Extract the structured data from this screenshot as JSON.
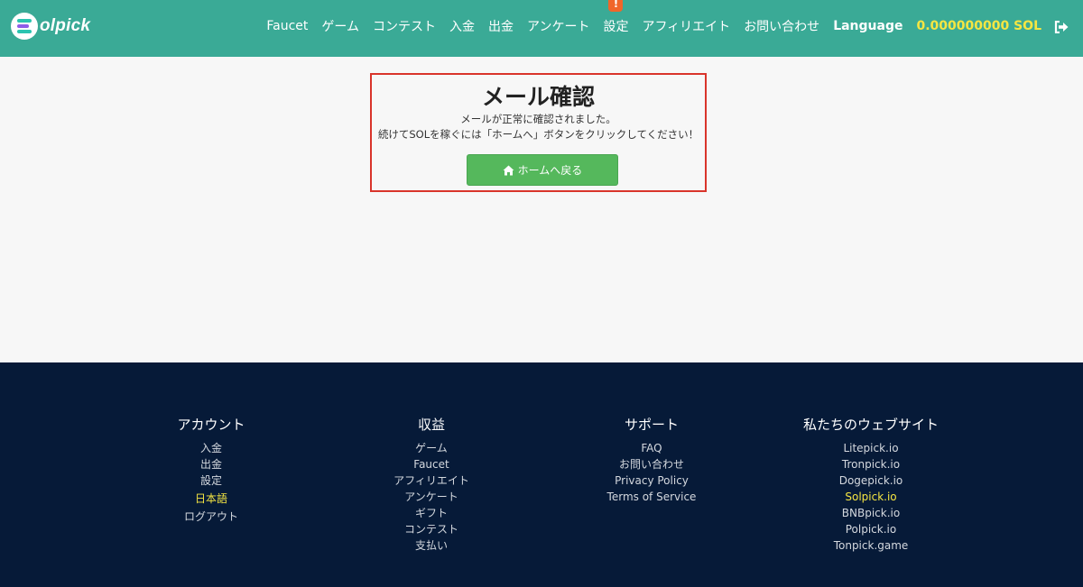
{
  "brand": {
    "name": "Solpick"
  },
  "nav": {
    "items": [
      "Faucet",
      "ゲーム",
      "コンテスト",
      "入金",
      "出金",
      "アンケート",
      "設定",
      "アフィリエイト",
      "お問い合わせ"
    ],
    "badge": "!",
    "language": "Language",
    "balance": "0.000000000 SOL",
    "logout_icon": "sign-out-icon"
  },
  "card": {
    "title": "メール確認",
    "line1": "メールが正常に確認されました。",
    "line2": "続けてSOLを稼ぐには「ホームへ」ボタンをクリックしてください！",
    "button": "ホームへ戻る",
    "button_icon": "home-icon",
    "button_color": "#55b85c",
    "highlight_color": "#d9342b"
  },
  "footer": {
    "account": {
      "title": "アカウント",
      "links": [
        "入金",
        "出金",
        "設定",
        "日本語",
        "ログアウト"
      ]
    },
    "earn": {
      "title": "収益",
      "links": [
        "ゲーム",
        "Faucet",
        "アフィリエイト",
        "アンケート",
        "ギフト",
        "コンテスト",
        "支払い"
      ]
    },
    "support": {
      "title": "サポート",
      "links": [
        "FAQ",
        "お問い合わせ",
        "Privacy Policy",
        "Terms of Service"
      ]
    },
    "sites": {
      "title": "私たちのウェブサイト",
      "links": [
        "Litepick.io",
        "Tronpick.io",
        "Dogepick.io",
        "Solpick.io",
        "BNBpick.io",
        "Polpick.io",
        "Tonpick.game"
      ]
    }
  },
  "colors": {
    "header": "#3aaa96",
    "footer": "#061a38",
    "accent_yellow": "#f5e642",
    "badge": "#f0662a"
  }
}
